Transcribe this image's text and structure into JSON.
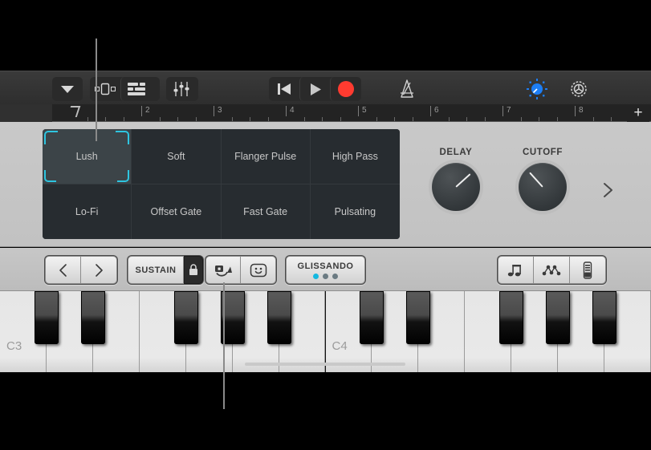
{
  "toolbar": {
    "nav_icon": "chevron-down-icon",
    "view_icons": [
      "tracks-view-icon",
      "editor-view-icon"
    ],
    "mixer_icon": "mixer-sliders-icon",
    "transport": {
      "rewind_label": "rewind-icon",
      "play_label": "play-icon",
      "record_label": "record-icon"
    },
    "metronome_icon": "metronome-icon",
    "fx_icon": "fx-knob-icon",
    "settings_icon": "gear-icon",
    "record_color": "#ff3b30",
    "fx_color": "#1d7ef5"
  },
  "ruler": {
    "bars": [
      "2",
      "3",
      "4",
      "5",
      "6",
      "7",
      "8"
    ],
    "add_label": "+",
    "playhead_position": "1"
  },
  "presets": {
    "items": [
      {
        "label": "Lush",
        "selected": true
      },
      {
        "label": "Soft",
        "selected": false
      },
      {
        "label": "Flanger Pulse",
        "selected": false
      },
      {
        "label": "High Pass",
        "selected": false
      },
      {
        "label": "Lo-Fi",
        "selected": false
      },
      {
        "label": "Offset Gate",
        "selected": false
      },
      {
        "label": "Fast Gate",
        "selected": false
      },
      {
        "label": "Pulsating",
        "selected": false
      }
    ],
    "selection_color": "#2ec5e0",
    "next_icon": "chevron-right-icon"
  },
  "knobs": [
    {
      "label": "DELAY",
      "angle": -132
    },
    {
      "label": "CUTOFF",
      "angle": 138
    }
  ],
  "keyboard_bar": {
    "prev_icon": "chevron-left-icon",
    "next_icon": "chevron-right-icon",
    "sustain_label": "SUSTAIN",
    "sustain_lock_icon": "lock-icon",
    "latch_icon": "sustain-latch-icon",
    "note_repeat_icon": "smiley-face-icon",
    "glissando_label": "GLISSANDO",
    "glissando_dots": [
      true,
      false,
      false
    ],
    "glissando_active_color": "#14b8e0",
    "scale_icon": "music-notes-icon",
    "arpeggiator_icon": "arpeggiator-dots-icon",
    "velocity_icon": "velocity-slider-icon"
  },
  "piano": {
    "octave_labels": [
      "C3",
      "C4"
    ],
    "white_key_count": 14,
    "black_key_count": 10
  }
}
